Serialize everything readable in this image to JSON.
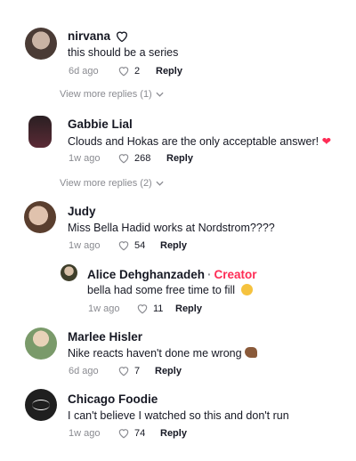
{
  "comments": [
    {
      "name": "nirvana",
      "text": "this should be a series",
      "time": "6d ago",
      "likes": "2",
      "reply": "Reply",
      "more": "View more replies (1)"
    },
    {
      "name": "Gabbie Lial",
      "text": "Clouds and Hokas are the only acceptable answer!",
      "time": "1w ago",
      "likes": "268",
      "reply": "Reply",
      "more": "View more replies (2)"
    },
    {
      "name": "Judy",
      "text": "Miss Bella Hadid works at Nordstrom????",
      "time": "1w ago",
      "likes": "54",
      "reply": "Reply"
    },
    {
      "name": "Alice Dehghanzadeh",
      "badge": "Creator",
      "text": "bella had some free time to fill",
      "time": "1w ago",
      "likes": "11",
      "reply": "Reply"
    },
    {
      "name": "Marlee Hisler",
      "text": "Nike reacts haven't done me wrong",
      "time": "6d ago",
      "likes": "7",
      "reply": "Reply"
    },
    {
      "name": "Chicago Foodie",
      "text": "I can't believe I watched so this and don't run",
      "time": "1w ago",
      "likes": "74",
      "reply": "Reply"
    }
  ],
  "colors": {
    "accent": "#fe2c55",
    "muted": "#8a8b91",
    "text": "#161823"
  }
}
